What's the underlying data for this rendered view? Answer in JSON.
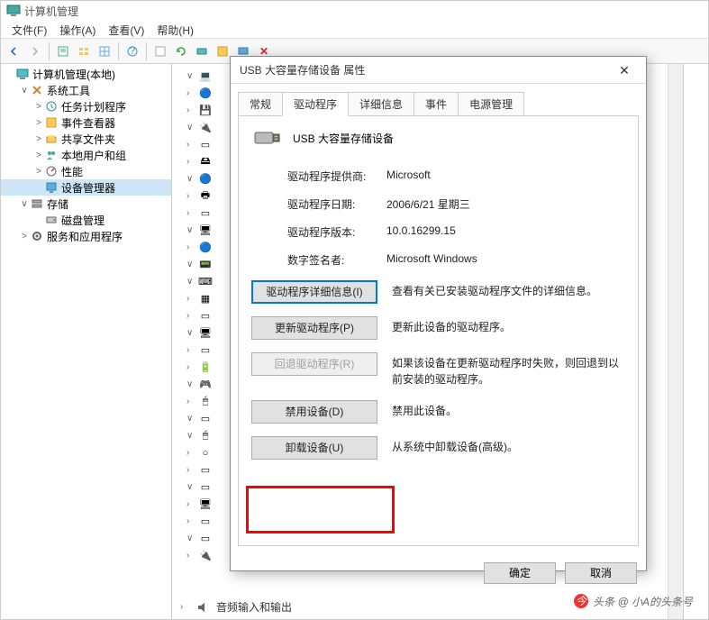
{
  "window": {
    "title": "计算机管理"
  },
  "menubar": [
    "文件(F)",
    "操作(A)",
    "查看(V)",
    "帮助(H)"
  ],
  "tree": [
    {
      "indent": 0,
      "exp": "",
      "icon": "computer",
      "label": "计算机管理(本地)"
    },
    {
      "indent": 1,
      "exp": "∨",
      "icon": "tools",
      "label": "系统工具"
    },
    {
      "indent": 2,
      "exp": ">",
      "icon": "task",
      "label": "任务计划程序"
    },
    {
      "indent": 2,
      "exp": ">",
      "icon": "event",
      "label": "事件查看器"
    },
    {
      "indent": 2,
      "exp": ">",
      "icon": "share",
      "label": "共享文件夹"
    },
    {
      "indent": 2,
      "exp": ">",
      "icon": "users",
      "label": "本地用户和组"
    },
    {
      "indent": 2,
      "exp": ">",
      "icon": "perf",
      "label": "性能"
    },
    {
      "indent": 2,
      "exp": "",
      "icon": "devmgr",
      "label": "设备管理器",
      "selected": true
    },
    {
      "indent": 1,
      "exp": "∨",
      "icon": "storage",
      "label": "存储"
    },
    {
      "indent": 2,
      "exp": "",
      "icon": "disk",
      "label": "磁盘管理"
    },
    {
      "indent": 1,
      "exp": ">",
      "icon": "services",
      "label": "服务和应用程序"
    }
  ],
  "dialog": {
    "title": "USB 大容量存储设备 属性",
    "close": "✕",
    "tabs": [
      "常规",
      "驱动程序",
      "详细信息",
      "事件",
      "电源管理"
    ],
    "active_tab": 1,
    "device_name": "USB 大容量存储设备",
    "info": [
      {
        "label": "驱动程序提供商:",
        "value": "Microsoft"
      },
      {
        "label": "驱动程序日期:",
        "value": "2006/6/21 星期三"
      },
      {
        "label": "驱动程序版本:",
        "value": "10.0.16299.15"
      },
      {
        "label": "数字签名者:",
        "value": "Microsoft Windows"
      }
    ],
    "actions": [
      {
        "btn": "驱动程序详细信息(I)",
        "desc": "查看有关已安装驱动程序文件的详细信息。",
        "focus": true
      },
      {
        "btn": "更新驱动程序(P)",
        "desc": "更新此设备的驱动程序。"
      },
      {
        "btn": "回退驱动程序(R)",
        "desc": "如果该设备在更新驱动程序时失败，则回退到以前安装的驱动程序。",
        "disabled": true
      },
      {
        "btn": "禁用设备(D)",
        "desc": "禁用此设备。"
      },
      {
        "btn": "卸载设备(U)",
        "desc": "从系统中卸载设备(高级)。"
      }
    ],
    "ok": "确定",
    "cancel": "取消"
  },
  "bottom_device": "音频输入和输出",
  "watermark": "头条 @ 小A的头条号"
}
